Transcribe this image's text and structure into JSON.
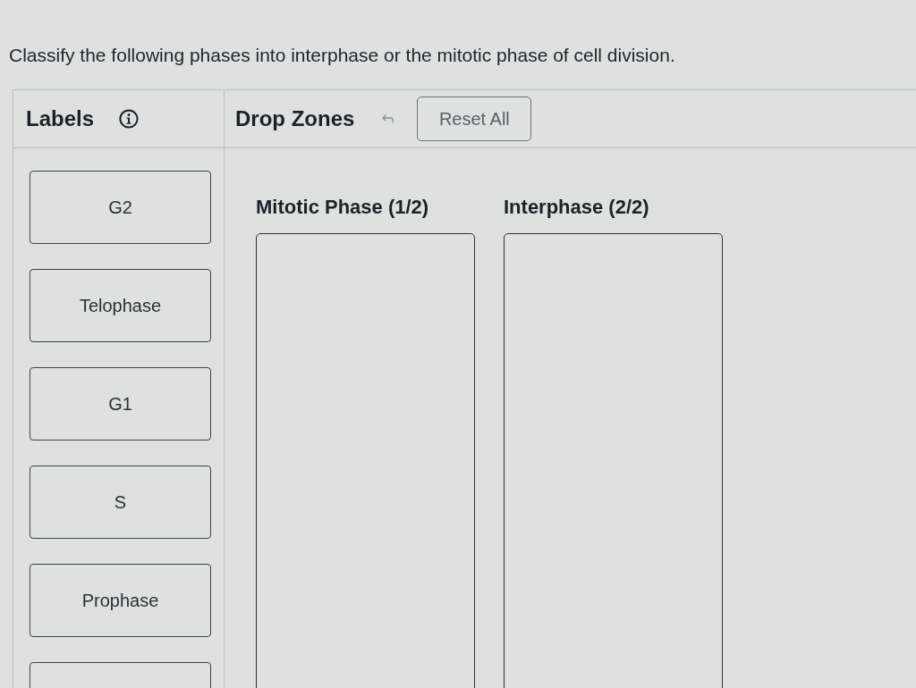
{
  "question": "Classify the following phases into interphase or the mitotic phase of cell division.",
  "labels_panel": {
    "title": "Labels",
    "items": [
      "G2",
      "Telophase",
      "G1",
      "S",
      "Prophase"
    ],
    "more_below": true
  },
  "drop_zones_panel": {
    "title": "Drop Zones",
    "reset_button": "Reset All",
    "zones": [
      {
        "title": "Mitotic Phase (1/2)"
      },
      {
        "title": "Interphase (2/2)"
      }
    ]
  }
}
